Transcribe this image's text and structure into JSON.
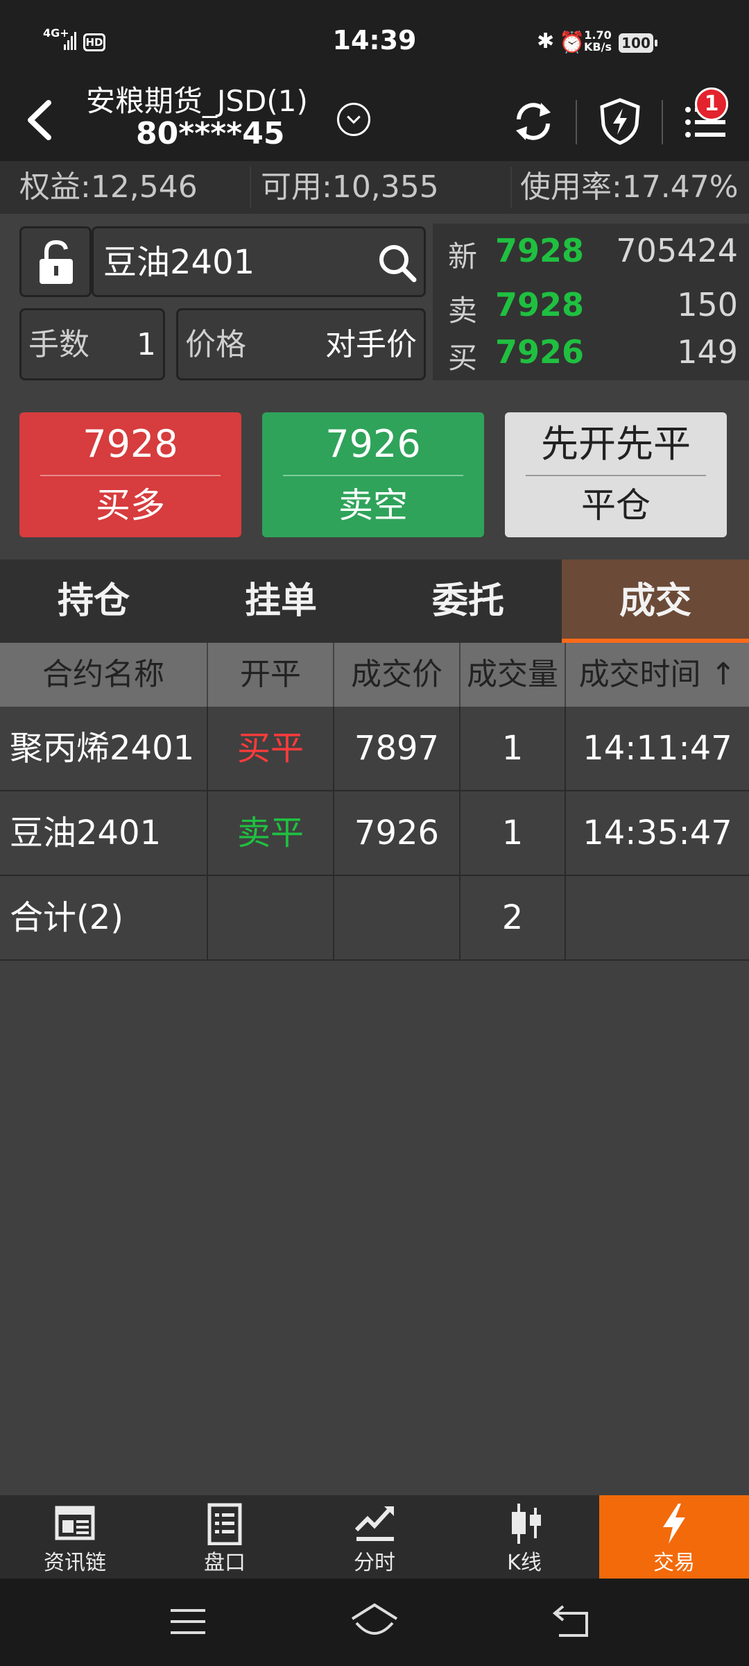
{
  "status_bar": {
    "network": "4G+",
    "hd": "HD",
    "time": "14:39",
    "speed_top": "1.70",
    "speed_bottom": "KB/s",
    "battery": "100",
    "icons": [
      "signal-icon",
      "bluetooth-icon",
      "alarm-icon",
      "battery-icon"
    ]
  },
  "header": {
    "account_name": "安粮期货_JSD(1)",
    "account_id": "80****45",
    "notification_count": "1",
    "icons": [
      "back-icon",
      "dropdown-icon",
      "refresh-icon",
      "shield-bolt-icon",
      "menu-list-icon"
    ]
  },
  "account_bar": {
    "equity": "权益:12,546",
    "available": "可用:10,355",
    "usage": "使用率:17.47%"
  },
  "order": {
    "symbol": "豆油2401",
    "qty_label": "手数",
    "qty_value": "1",
    "price_label": "价格",
    "price_value": "对手价"
  },
  "quote": {
    "last_label": "新",
    "last_price": "7928",
    "volume": "705424",
    "ask_label": "卖",
    "ask_price": "7928",
    "ask_qty": "150",
    "bid_label": "买",
    "bid_price": "7926",
    "bid_qty": "149"
  },
  "buttons": {
    "buy_price": "7928",
    "buy_label": "买多",
    "sell_price": "7926",
    "sell_label": "卖空",
    "close_mode": "先开先平",
    "close_label": "平仓"
  },
  "tabs": [
    "持仓",
    "挂单",
    "委托",
    "成交"
  ],
  "table": {
    "headers": [
      "合约名称",
      "开平",
      "成交价",
      "成交量",
      "成交时间 ↑"
    ],
    "rows": [
      {
        "name": "聚丙烯2401",
        "side": "买平",
        "price": "7897",
        "qty": "1",
        "time": "14:11:47"
      },
      {
        "name": "豆油2401",
        "side": "卖平",
        "price": "7926",
        "qty": "1",
        "time": "14:35:47"
      }
    ],
    "total": {
      "name": "合计(2)",
      "qty": "2"
    }
  },
  "bottom_nav": [
    "资讯链",
    "盘口",
    "分时",
    "K线",
    "交易"
  ],
  "colors": {
    "buy": "#d73c3e",
    "sell": "#2fa35a",
    "accent": "#f26a0a",
    "price_green": "#1fc040",
    "side_red": "#ff3b3b"
  }
}
